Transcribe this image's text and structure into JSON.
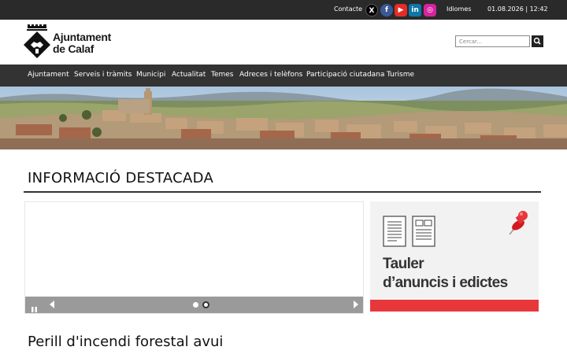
{
  "topbar": {
    "contact_label": "Contacte",
    "social": [
      {
        "name": "x-icon",
        "glyph": "X"
      },
      {
        "name": "facebook-icon",
        "glyph": "f"
      },
      {
        "name": "youtube-icon",
        "glyph": "▶"
      },
      {
        "name": "linkedin-icon",
        "glyph": "in"
      },
      {
        "name": "instagram-icon",
        "glyph": "◎"
      }
    ],
    "languages_label": "Idiomes",
    "datetime": "01.08.2026 | 12:42"
  },
  "header": {
    "logo_line1": "Ajuntament",
    "logo_line2": "de Calaf",
    "search_placeholder": "Cercar..."
  },
  "nav": {
    "items": [
      "Ajuntament",
      "Serveis i tràmits",
      "Municipi",
      "Actualitat",
      "Temes",
      "Adreces i telèfons",
      "Participació ciutadana",
      "Turisme"
    ]
  },
  "featured": {
    "title": "INFORMACIÓ DESTACADA"
  },
  "tauler": {
    "line1": "Tauler",
    "line2": "d’anuncis i edictes",
    "accent_color": "#e8373a"
  },
  "alert": {
    "title": "Perill d'incendi forestal avui"
  }
}
